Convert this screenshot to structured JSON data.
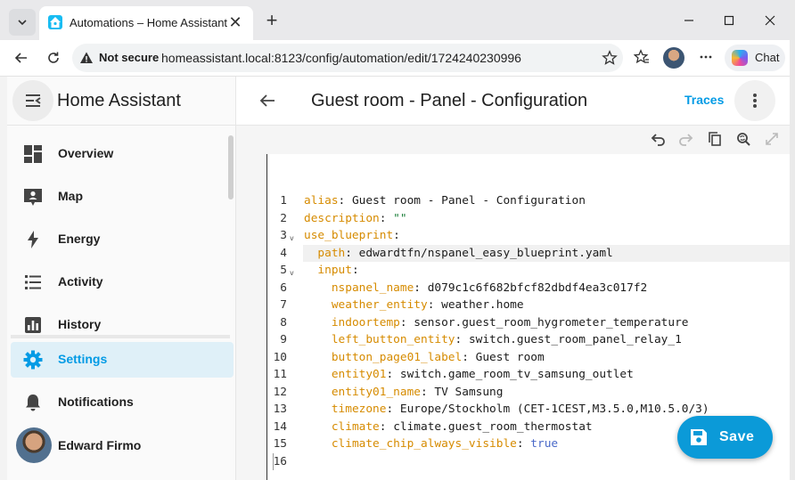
{
  "browser": {
    "tab_title": "Automations – Home Assistant",
    "security_label": "Not secure",
    "url": "homeassistant.local:8123/config/automation/edit/1724240230996",
    "chat_label": "Chat"
  },
  "sidebar": {
    "app_title": "Home Assistant",
    "items": [
      {
        "label": "Overview",
        "icon": "overview-icon"
      },
      {
        "label": "Map",
        "icon": "map-icon"
      },
      {
        "label": "Energy",
        "icon": "energy-icon"
      },
      {
        "label": "Activity",
        "icon": "activity-icon"
      },
      {
        "label": "History",
        "icon": "history-icon"
      },
      {
        "label": "Settings",
        "icon": "settings-icon",
        "active": true
      },
      {
        "label": "Notifications",
        "icon": "bell-icon"
      }
    ],
    "user_name": "Edward Firmo"
  },
  "main": {
    "title": "Guest room - Panel - Configuration",
    "traces_label": "Traces",
    "save_label": "Save"
  },
  "editor": {
    "lines": [
      {
        "n": "1",
        "indent": "",
        "key": "alias",
        "value": "Guest room - Panel - Configuration",
        "type": "plain"
      },
      {
        "n": "2",
        "indent": "",
        "key": "description",
        "value": "\"\"",
        "type": "quoted"
      },
      {
        "n": "3",
        "indent": "",
        "key": "use_blueprint",
        "value": "",
        "type": "plain",
        "fold": true
      },
      {
        "n": "4",
        "indent": "  ",
        "key": "path",
        "value": "edwardtfn/nspanel_easy_blueprint.yaml",
        "type": "plain",
        "highlight": true
      },
      {
        "n": "5",
        "indent": "  ",
        "key": "input",
        "value": "",
        "type": "plain",
        "fold": true
      },
      {
        "n": "6",
        "indent": "    ",
        "key": "nspanel_name",
        "value": "d079c1c6f682bfcf82dbdf4ea3c017f2",
        "type": "plain"
      },
      {
        "n": "7",
        "indent": "    ",
        "key": "weather_entity",
        "value": "weather.home",
        "type": "plain"
      },
      {
        "n": "8",
        "indent": "    ",
        "key": "indoortemp",
        "value": "sensor.guest_room_hygrometer_temperature",
        "type": "plain"
      },
      {
        "n": "9",
        "indent": "    ",
        "key": "left_button_entity",
        "value": "switch.guest_room_panel_relay_1",
        "type": "plain"
      },
      {
        "n": "10",
        "indent": "    ",
        "key": "button_page01_label",
        "value": "Guest room",
        "type": "plain"
      },
      {
        "n": "11",
        "indent": "    ",
        "key": "entity01",
        "value": "switch.game_room_tv_samsung_outlet",
        "type": "plain"
      },
      {
        "n": "12",
        "indent": "    ",
        "key": "entity01_name",
        "value": "TV Samsung",
        "type": "plain"
      },
      {
        "n": "13",
        "indent": "    ",
        "key": "timezone",
        "value": "Europe/Stockholm (CET-1CEST,M3.5.0,M10.5.0/3)",
        "type": "plain"
      },
      {
        "n": "14",
        "indent": "    ",
        "key": "climate",
        "value": "climate.guest_room_thermostat",
        "type": "plain"
      },
      {
        "n": "15",
        "indent": "    ",
        "key": "climate_chip_always_visible",
        "value": "true",
        "type": "bool"
      },
      {
        "n": "16",
        "indent": "",
        "key": "",
        "value": "",
        "type": "plain"
      }
    ]
  },
  "colors": {
    "accent": "#039be5",
    "fab": "#0b9ad8",
    "yaml_key": "#d68b00",
    "yaml_bool": "#4a69c8"
  }
}
